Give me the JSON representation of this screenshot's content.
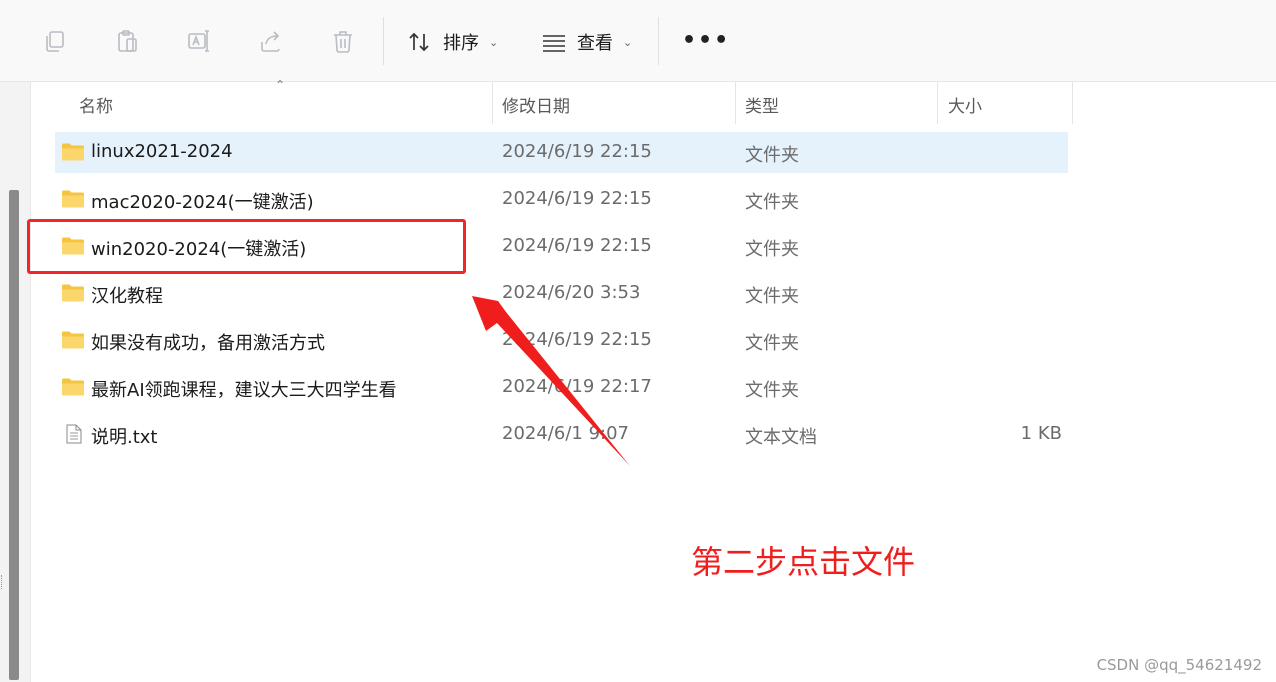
{
  "toolbar": {
    "icons": [
      "copy-icon",
      "paste-icon",
      "rename-icon",
      "share-icon",
      "delete-icon"
    ],
    "sort_label": "排序",
    "view_label": "查看",
    "more_label": "•••"
  },
  "columns": {
    "name": "名称",
    "date": "修改日期",
    "type": "类型",
    "size": "大小"
  },
  "files": [
    {
      "name": "linux2021-2024",
      "date": "2024/6/19 22:15",
      "type": "文件夹",
      "size": "",
      "icon": "folder-icon"
    },
    {
      "name": "mac2020-2024(一键激活)",
      "date": "2024/6/19 22:15",
      "type": "文件夹",
      "size": "",
      "icon": "folder-icon"
    },
    {
      "name": "win2020-2024(一键激活)",
      "date": "2024/6/19 22:15",
      "type": "文件夹",
      "size": "",
      "icon": "folder-icon"
    },
    {
      "name": "汉化教程",
      "date": "2024/6/20 3:53",
      "type": "文件夹",
      "size": "",
      "icon": "folder-icon"
    },
    {
      "name": "如果没有成功，备用激活方式",
      "date": "2024/6/19 22:15",
      "type": "文件夹",
      "size": "",
      "icon": "folder-icon"
    },
    {
      "name": "最新AI领跑课程，建议大三大四学生看",
      "date": "2024/6/19 22:17",
      "type": "文件夹",
      "size": "",
      "icon": "folder-icon"
    },
    {
      "name": "说明.txt",
      "date": "2024/6/1 9:07",
      "type": "文本文档",
      "size": "1 KB",
      "icon": "text-file-icon"
    }
  ],
  "annotation": {
    "instruction": "第二步点击文件",
    "color": "#f01d1d"
  },
  "watermark": "CSDN @qq_54621492",
  "colors": {
    "selected_row": "#e5f1fb",
    "folder": "#f5c542"
  }
}
